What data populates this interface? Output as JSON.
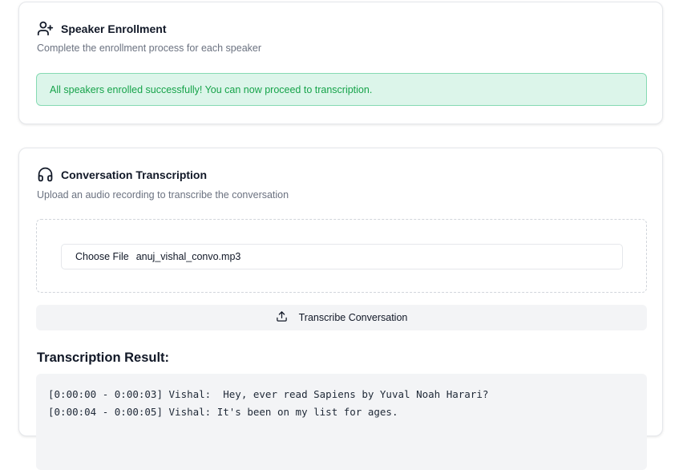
{
  "enrollment": {
    "title": "Speaker Enrollment",
    "title_icon": "user-plus-icon",
    "description": "Complete the enrollment process for each speaker",
    "success_message": "All speakers enrolled successfully! You can now proceed to transcription."
  },
  "transcription": {
    "title": "Conversation Transcription",
    "title_icon": "headphones-icon",
    "description": "Upload an audio recording to transcribe the conversation",
    "file_input": {
      "button_label": "Choose File",
      "file_name": "anuj_vishal_convo.mp3"
    },
    "transcribe_button": {
      "label": "Transcribe Conversation",
      "icon": "upload-icon"
    },
    "result": {
      "heading": "Transcription Result:",
      "lines": [
        "[0:00:00 - 0:00:03] Vishal:  Hey, ever read Sapiens by Yuval Noah Harari?",
        "[0:00:04 - 0:00:05] Vishal: It's been on my list for ages."
      ]
    }
  },
  "colors": {
    "success_bg": "#dcf5ea",
    "success_border": "#86dab3",
    "success_text": "#16a34a",
    "muted_text": "#6b7280",
    "button_bg": "#f3f4f6"
  }
}
